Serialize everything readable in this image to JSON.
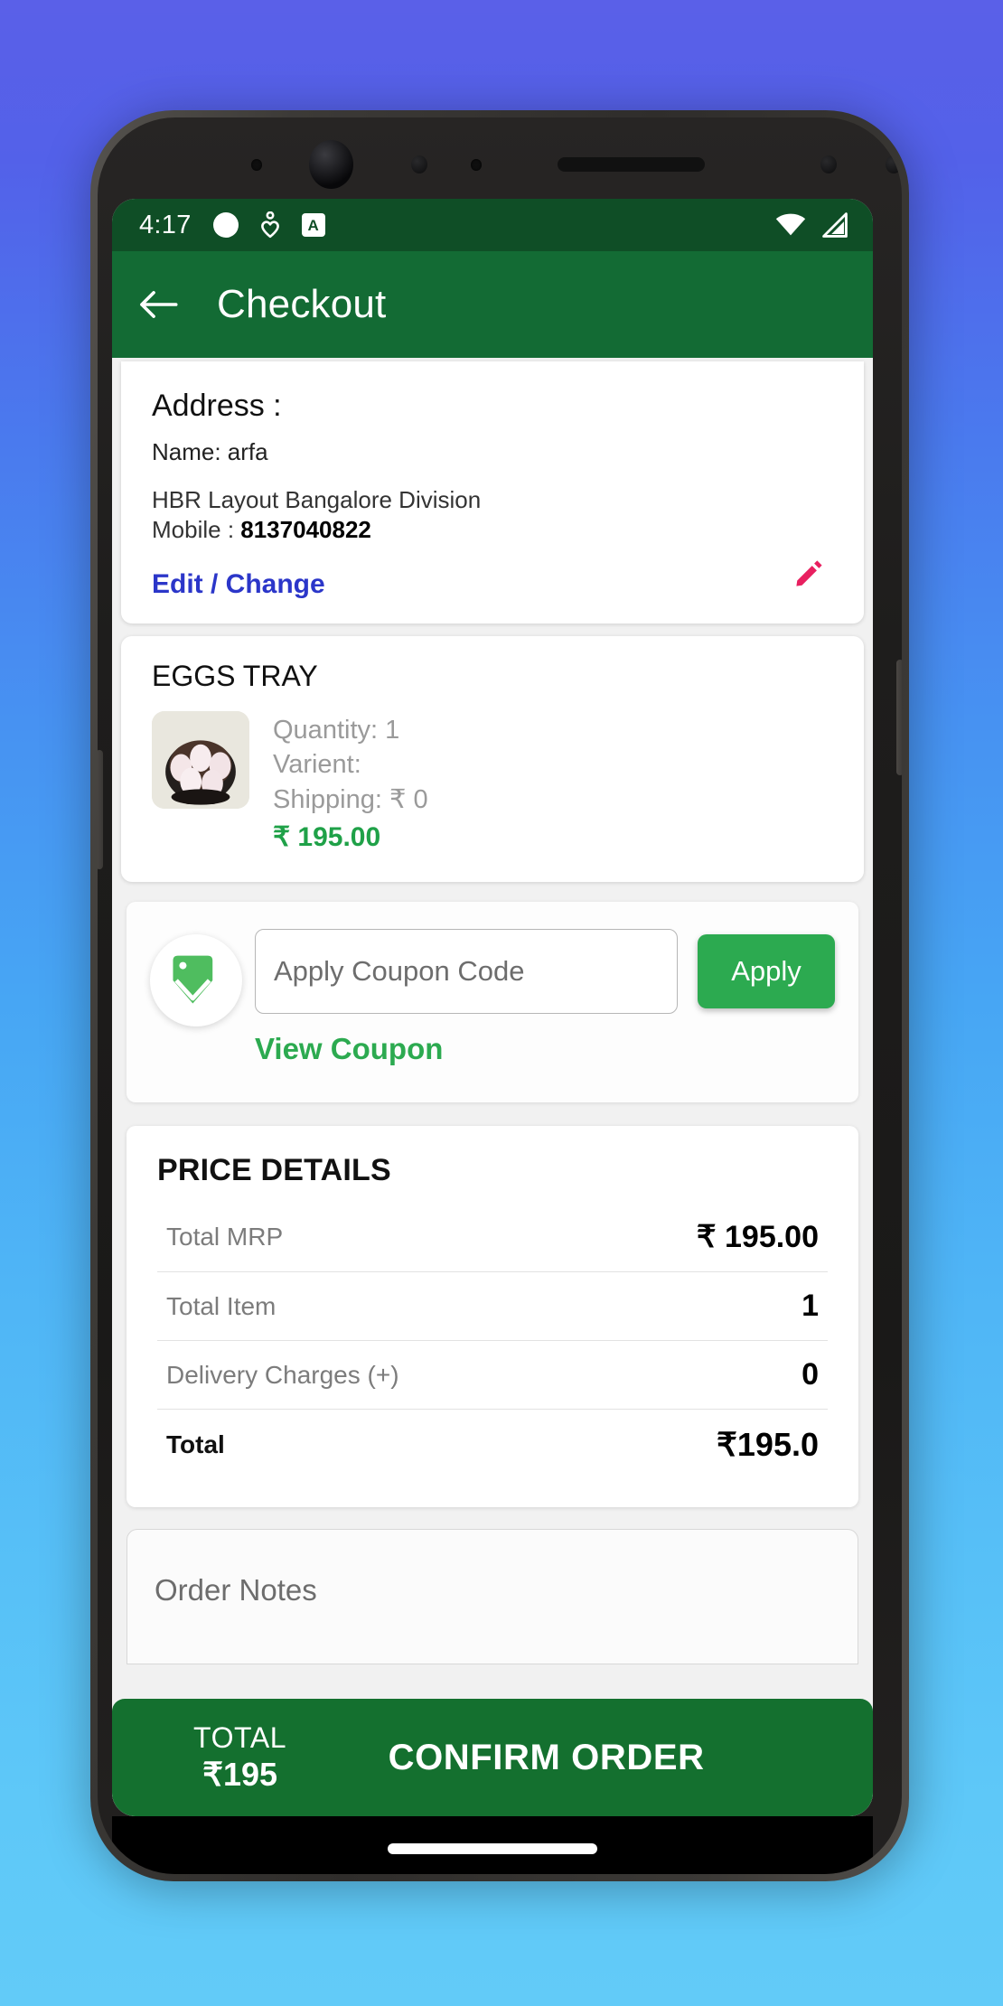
{
  "theme": {
    "status_bar_green": "#0f4e26",
    "app_bar_green": "#136b34",
    "accent_green": "#2caa50",
    "price_green": "#1fa148",
    "link_blue": "#2b36c9",
    "pencil_pink": "#e82060",
    "bottom_bar_green": "#14702f"
  },
  "status_bar": {
    "time": "4:17",
    "icons": [
      "circle-icon",
      "heart-pin-icon",
      "a-badge-icon"
    ],
    "badge_letter": "A",
    "right_icons": [
      "wifi-icon",
      "signal-icon"
    ]
  },
  "app_bar": {
    "back_icon": "arrow-left-icon",
    "title": "Checkout"
  },
  "address": {
    "title": "Address :",
    "name_line": "Name: arfa",
    "address_line": "HBR Layout Bangalore Division",
    "mobile_label": "Mobile : ",
    "mobile_number": "8137040822",
    "edit_label": "Edit / Change",
    "edit_icon": "pencil-icon"
  },
  "product": {
    "title": "EGGS TRAY",
    "thumbnail": "eggs-tray-image",
    "quantity": "Quantity: 1",
    "varient": "Varient:",
    "shipping": "Shipping:  ₹ 0",
    "price": "₹ 195.00"
  },
  "coupon": {
    "icon": "coupon-tag-icon",
    "placeholder": "Apply Coupon Code",
    "value": "",
    "apply_label": "Apply",
    "view_label": "View Coupon"
  },
  "price_details": {
    "title": "PRICE DETAILS",
    "rows": [
      {
        "label": "Total MRP",
        "value": "₹ 195.00"
      },
      {
        "label": "Total Item",
        "value": "1"
      },
      {
        "label": "Delivery Charges (+)",
        "value": "0"
      }
    ],
    "total": {
      "label": "Total",
      "value": "₹195.0"
    }
  },
  "order_notes": {
    "placeholder": "Order Notes",
    "value": ""
  },
  "bottom_bar": {
    "total_label": "TOTAL",
    "total_value": "₹195",
    "confirm_label": "CONFIRM ORDER"
  }
}
